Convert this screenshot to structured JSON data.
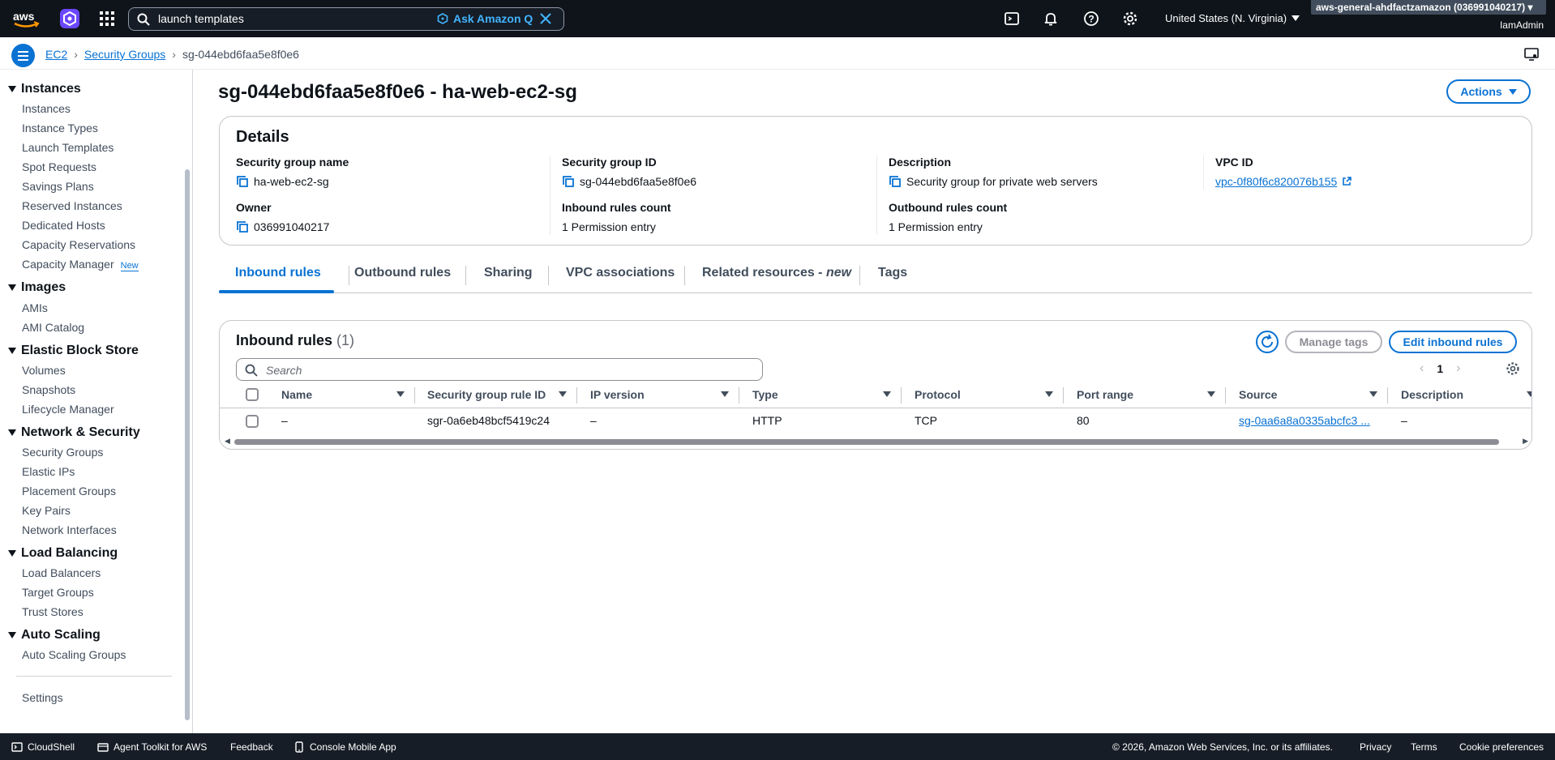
{
  "topnav": {
    "search_value": "launch templates",
    "ask_q_label": "Ask Amazon Q",
    "region": "United States (N. Virginia)",
    "account": "aws-general-ahdfactzamazon (036991040217)",
    "user": "IamAdmin"
  },
  "breadcrumb": {
    "items": [
      "EC2",
      "Security Groups",
      "sg-044ebd6faa5e8f0e6"
    ]
  },
  "sidebar": {
    "sections": [
      {
        "title": "Instances",
        "items": [
          "Instances",
          "Instance Types",
          "Launch Templates",
          "Spot Requests",
          "Savings Plans",
          "Reserved Instances",
          "Dedicated Hosts",
          "Capacity Reservations",
          "Capacity Manager"
        ]
      },
      {
        "title": "Images",
        "items": [
          "AMIs",
          "AMI Catalog"
        ]
      },
      {
        "title": "Elastic Block Store",
        "items": [
          "Volumes",
          "Snapshots",
          "Lifecycle Manager"
        ]
      },
      {
        "title": "Network & Security",
        "items": [
          "Security Groups",
          "Elastic IPs",
          "Placement Groups",
          "Key Pairs",
          "Network Interfaces"
        ]
      },
      {
        "title": "Load Balancing",
        "items": [
          "Load Balancers",
          "Target Groups",
          "Trust Stores"
        ]
      },
      {
        "title": "Auto Scaling",
        "items": [
          "Auto Scaling Groups"
        ]
      }
    ],
    "new_badge": "New",
    "settings": "Settings"
  },
  "page": {
    "title": "sg-044ebd6faa5e8f0e6 - ha-web-ec2-sg",
    "actions_label": "Actions"
  },
  "details": {
    "heading": "Details",
    "fields": {
      "sg_name_label": "Security group name",
      "sg_name": "ha-web-ec2-sg",
      "sg_id_label": "Security group ID",
      "sg_id": "sg-044ebd6faa5e8f0e6",
      "description_label": "Description",
      "description": "Security group for private web servers",
      "vpc_label": "VPC ID",
      "vpc_id": "vpc-0f80f6c820076b155",
      "owner_label": "Owner",
      "owner": "036991040217",
      "inbound_count_label": "Inbound rules count",
      "inbound_count": "1 Permission entry",
      "outbound_count_label": "Outbound rules count",
      "outbound_count": "1 Permission entry"
    }
  },
  "tabs": {
    "inbound": "Inbound rules",
    "outbound": "Outbound rules",
    "sharing": "Sharing",
    "vpc_assoc": "VPC associations",
    "related": "Related resources - ",
    "related_new": "new",
    "tags": "Tags"
  },
  "inbound": {
    "title": "Inbound rules",
    "count": "(1)",
    "manage_tags": "Manage tags",
    "edit": "Edit inbound rules",
    "search_placeholder": "Search",
    "page": "1",
    "columns": [
      "Name",
      "Security group rule ID",
      "IP version",
      "Type",
      "Protocol",
      "Port range",
      "Source",
      "Description"
    ],
    "rows": [
      {
        "name": "–",
        "rule_id": "sgr-0a6eb48bcf5419c24",
        "ip_version": "–",
        "type": "HTTP",
        "protocol": "TCP",
        "port_range": "80",
        "source": "sg-0aa6a8a0335abcfc3 ...",
        "description": "–"
      }
    ]
  },
  "footer": {
    "cloudshell": "CloudShell",
    "agent_toolkit": "Agent Toolkit for AWS",
    "feedback": "Feedback",
    "mobile_app": "Console Mobile App",
    "copyright": "© 2026, Amazon Web Services, Inc. or its affiliates.",
    "privacy": "Privacy",
    "terms": "Terms",
    "cookies": "Cookie preferences"
  }
}
